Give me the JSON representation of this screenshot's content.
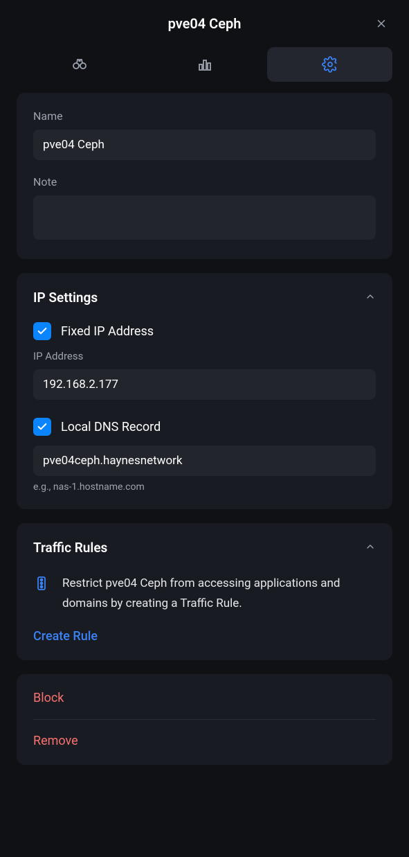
{
  "header": {
    "title": "pve04 Ceph"
  },
  "basic": {
    "name_label": "Name",
    "name_value": "pve04 Ceph",
    "note_label": "Note",
    "note_value": ""
  },
  "ip_settings": {
    "title": "IP Settings",
    "fixed_ip": {
      "label": "Fixed IP Address",
      "checked": true
    },
    "ip_address": {
      "label": "IP Address",
      "value": "192.168.2.177"
    },
    "local_dns": {
      "label": "Local DNS Record",
      "checked": true,
      "value": "pve04ceph.haynesnetwork",
      "hint": "e.g., nas-1.hostname.com"
    }
  },
  "traffic_rules": {
    "title": "Traffic Rules",
    "description": "Restrict pve04 Ceph from accessing applications and domains by creating a Traffic Rule.",
    "create_label": "Create Rule"
  },
  "actions": {
    "block": "Block",
    "remove": "Remove"
  }
}
